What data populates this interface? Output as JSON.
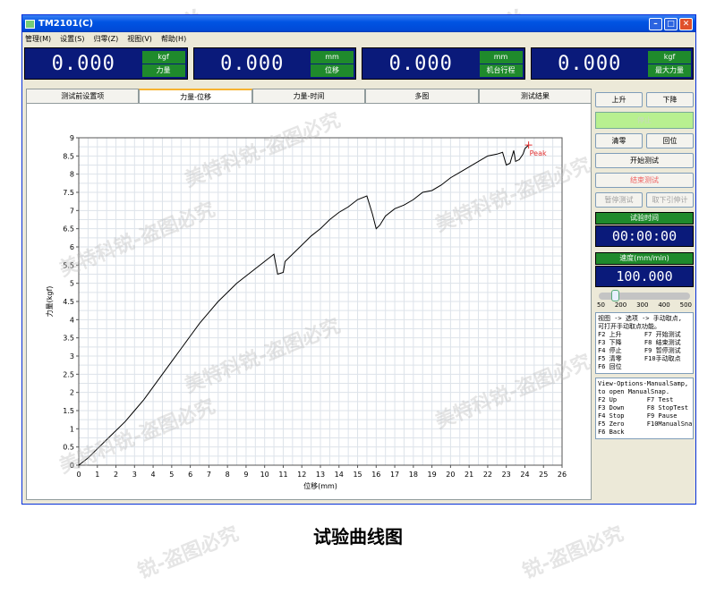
{
  "window": {
    "title": "TM2101(C)"
  },
  "menu": [
    "管理(M)",
    "设置(S)",
    "归零(Z)",
    "视图(V)",
    "帮助(H)"
  ],
  "readouts": [
    {
      "value": "0.000",
      "unit": "kgf",
      "label": "力量"
    },
    {
      "value": "0.000",
      "unit": "mm",
      "label": "位移"
    },
    {
      "value": "0.000",
      "unit": "mm",
      "label": "机台行程"
    },
    {
      "value": "0.000",
      "unit": "kgf",
      "label": "最大力量"
    }
  ],
  "tabs": [
    "测试前设置项",
    "力量-位移",
    "力量-时间",
    "多图",
    "测试结果"
  ],
  "active_tab": 1,
  "side": {
    "up": "上升",
    "down": "下降",
    "stop": "停止",
    "zero": "清零",
    "back": "回位",
    "start": "开始测试",
    "end": "结束测试",
    "pause": "暂停测试",
    "remove": "取下引伸计",
    "time_title": "试验时间",
    "time_value": "00:00:00",
    "speed_title": "速度(mm/min)",
    "speed_value": "100.000",
    "slider_ticks": [
      "50",
      "200",
      "300",
      "400",
      "500"
    ],
    "help_cn": "视图 -> 选项 -> 手动取点,\n可打开手动取点功能。\nF2 上升      F7 开始测试\nF3 下降      F8 结束测试\nF4 停止      F9 暂停测试\nF5 清零      F10手动取点\nF6 回位",
    "help_en": "View-Options-ManualSamp,\nto open ManualSnap.\nF2 Up        F7 Test\nF3 Down      F8 StopTest\nF4 Stop      F9 Pause\nF5 Zero      F10ManualSnap\nF6 Back"
  },
  "chart_data": {
    "type": "line",
    "xlabel": "位移(mm)",
    "ylabel": "力量(kgf)",
    "xlim": [
      0,
      26
    ],
    "ylim": [
      0,
      9
    ],
    "xticks": [
      0,
      1,
      2,
      3,
      4,
      5,
      6,
      7,
      8,
      9,
      10,
      11,
      12,
      13,
      14,
      15,
      16,
      17,
      18,
      19,
      20,
      21,
      22,
      23,
      24,
      25,
      26
    ],
    "yticks": [
      0,
      0.5,
      1,
      1.5,
      2,
      2.5,
      3,
      3.5,
      4,
      4.5,
      5,
      5.5,
      6,
      6.5,
      7,
      7.5,
      8,
      8.5,
      9
    ],
    "grid": true,
    "annotation": "Peak",
    "series": [
      {
        "color": "#000000",
        "x": [
          0,
          0.5,
          1,
          1.5,
          2,
          2.5,
          3,
          3.5,
          4,
          4.5,
          5,
          5.5,
          6,
          6.5,
          7,
          7.5,
          8,
          8.5,
          9,
          9.5,
          10,
          10.5,
          10.7,
          11,
          11.1,
          11.5,
          12,
          12.5,
          13,
          13.5,
          14,
          14.5,
          15,
          15.5,
          15.8,
          16,
          16.2,
          16.5,
          17,
          17.5,
          18,
          18.5,
          19,
          19.5,
          20,
          20.5,
          21,
          21.5,
          22,
          22.5,
          22.8,
          23,
          23.2,
          23.4,
          23.5,
          23.7,
          23.9,
          24,
          24.2
        ],
        "y": [
          0,
          0.2,
          0.45,
          0.7,
          0.95,
          1.2,
          1.5,
          1.8,
          2.15,
          2.5,
          2.85,
          3.2,
          3.55,
          3.9,
          4.2,
          4.5,
          4.75,
          5.0,
          5.2,
          5.4,
          5.6,
          5.8,
          5.25,
          5.3,
          5.6,
          5.8,
          6.05,
          6.3,
          6.5,
          6.75,
          6.95,
          7.1,
          7.3,
          7.4,
          6.9,
          6.5,
          6.6,
          6.85,
          7.05,
          7.15,
          7.3,
          7.5,
          7.55,
          7.7,
          7.9,
          8.05,
          8.2,
          8.35,
          8.5,
          8.55,
          8.6,
          8.25,
          8.3,
          8.65,
          8.35,
          8.4,
          8.55,
          8.7,
          8.8
        ]
      }
    ]
  }
}
